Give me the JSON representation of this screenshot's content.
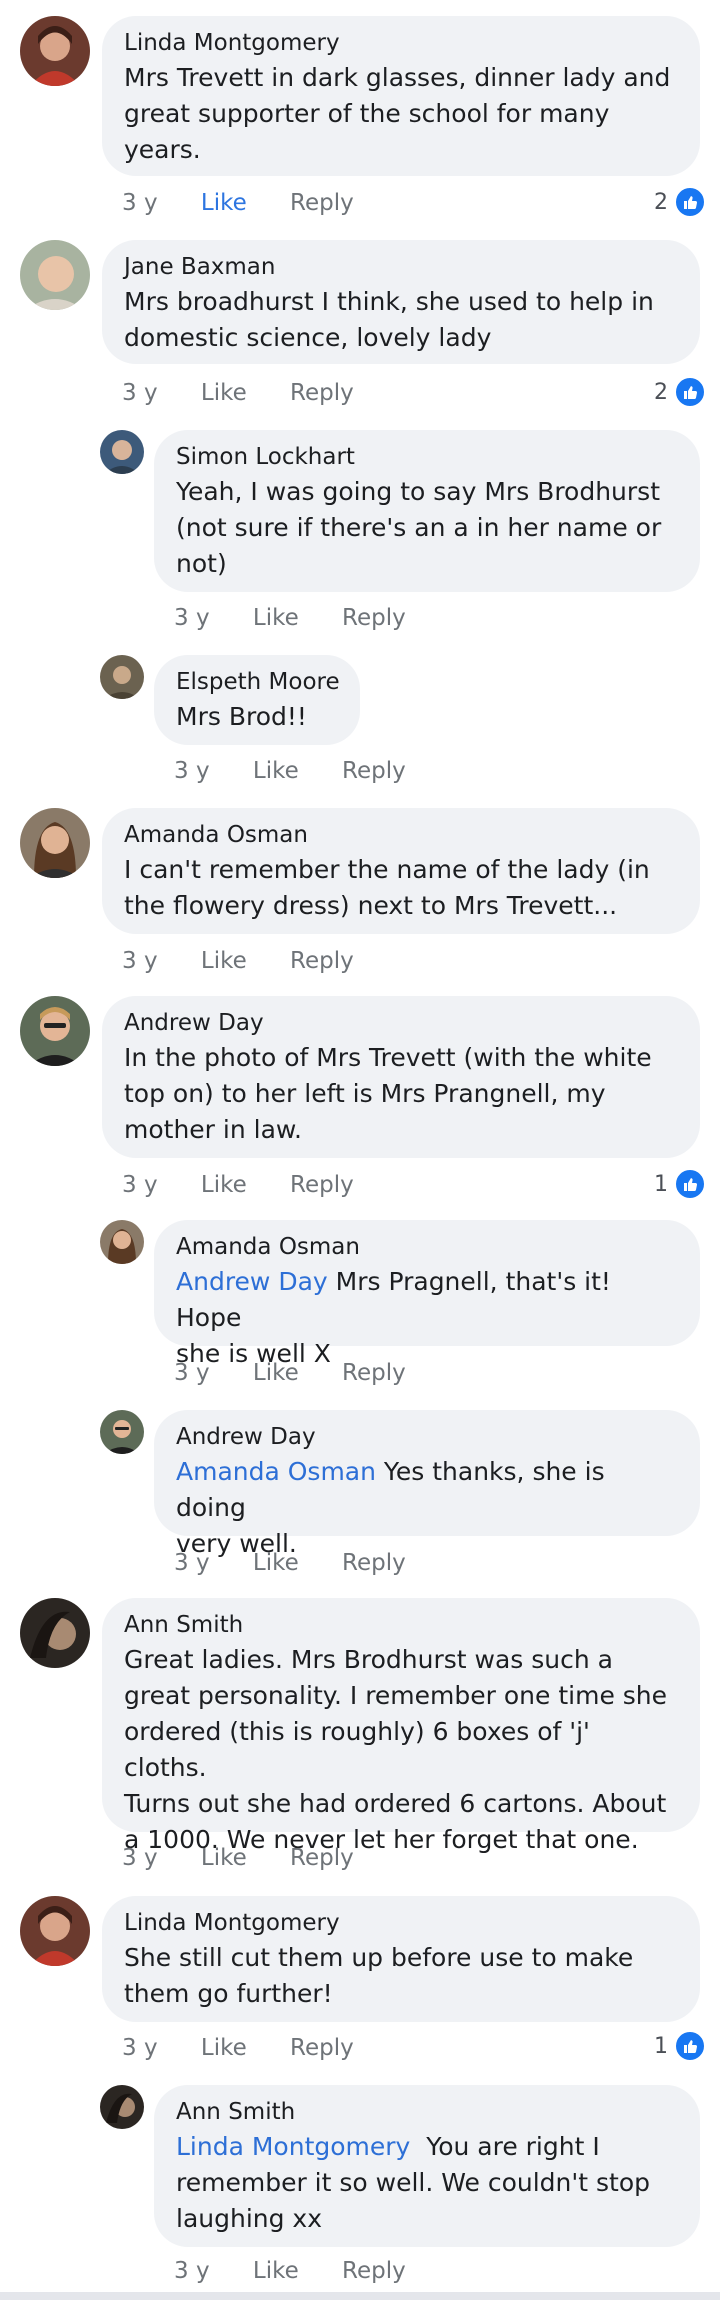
{
  "actions": {
    "time": "3 y",
    "like": "Like",
    "reply": "Reply"
  },
  "colors": {
    "bubble": "#f0f2f5",
    "mention": "#2d6fd6",
    "like_blue": "#1877f2"
  },
  "comments": [
    {
      "name": "Linda Montgomery",
      "lines": [
        "Mrs Trevett in dark glasses, dinner lady and",
        "great supporter of the school for many",
        "years."
      ],
      "reactions": "2"
    },
    {
      "name": "Jane Baxman",
      "lines": [
        "Mrs broadhurst  I think, she used to help in",
        "domestic science,  lovely lady"
      ],
      "reactions": "2"
    },
    {
      "name": "Simon Lockhart",
      "lines": [
        "Yeah, I was going to say Mrs Brodhurst",
        "(not sure if there's an a in her name or",
        "not)"
      ]
    },
    {
      "name": "Elspeth Moore",
      "lines": [
        "Mrs Brod!!"
      ]
    },
    {
      "name": "Amanda Osman",
      "lines": [
        "I can't remember the name of the lady (in",
        "the flowery dress) next to Mrs Trevett..."
      ]
    },
    {
      "name": "Andrew Day",
      "lines": [
        "In the photo of Mrs Trevett (with the white",
        "top on) to her left is Mrs Prangnell, my",
        "mother in law."
      ],
      "reactions": "1"
    },
    {
      "name": "Amanda Osman",
      "mention": "Andrew Day",
      "lines": [
        " Mrs Pragnell, that's it! Hope",
        "she is well X"
      ]
    },
    {
      "name": "Andrew Day",
      "mention": "Amanda Osman",
      "lines": [
        " Yes thanks, she is doing",
        "very well."
      ]
    },
    {
      "name": "Ann Smith",
      "lines": [
        "Great ladies. Mrs Brodhurst was such a",
        "great personality. I remember one time she",
        "ordered (this is roughly) 6 boxes of 'j' cloths.",
        "Turns out she had ordered 6 cartons. About",
        "a 1000. We never let her forget that one."
      ]
    },
    {
      "name": "Linda Montgomery",
      "lines": [
        "She still cut them up before use to make",
        "them go further!"
      ],
      "reactions": "1"
    },
    {
      "name": "Ann Smith",
      "mention": "Linda Montgomery",
      "lines": [
        "  You are right I",
        "remember it so well. We couldn't stop",
        "laughing xx"
      ]
    }
  ]
}
